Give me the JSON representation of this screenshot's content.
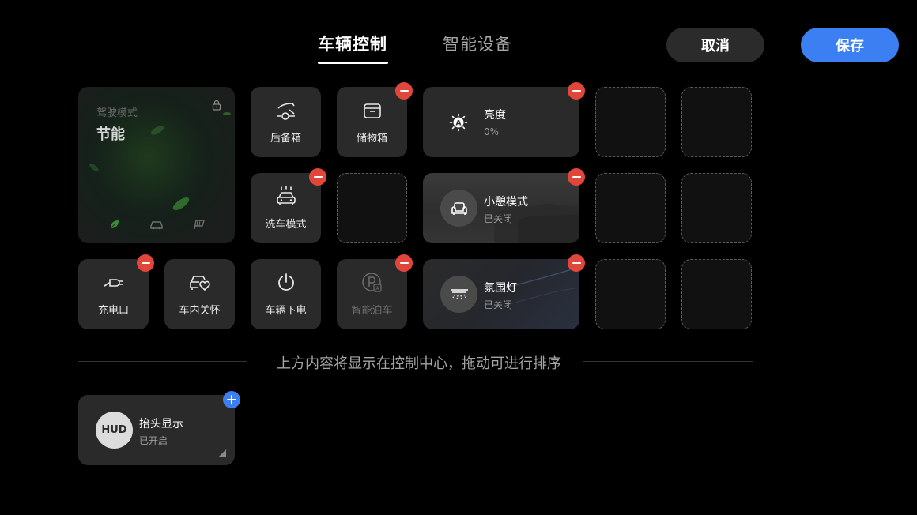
{
  "header": {
    "tabs": [
      {
        "label": "车辆控制",
        "active": true
      },
      {
        "label": "智能设备",
        "active": false
      }
    ],
    "cancel_label": "取消",
    "save_label": "保存"
  },
  "colors": {
    "accent": "#3b7ff2",
    "remove": "#e0473a",
    "tile_bg": "#2a2a2a",
    "background": "#000000"
  },
  "driving_mode": {
    "title": "驾驶模式",
    "mode": "节能",
    "icons": [
      "leaf-icon",
      "car-icon",
      "flag-icon"
    ]
  },
  "tiles": {
    "trunk": {
      "label": "后备箱",
      "icon": "trunk-icon"
    },
    "storage": {
      "label": "储物箱",
      "icon": "storage-box-icon"
    },
    "car_wash": {
      "label": "洗车模式",
      "icon": "car-wash-icon"
    },
    "charge_port": {
      "label": "充电口",
      "icon": "charging-plug-icon"
    },
    "cabin_care": {
      "label": "车内关怀",
      "icon": "car-heart-icon"
    },
    "power_off": {
      "label": "车辆下电",
      "icon": "power-icon"
    },
    "smart_parking": {
      "label": "智能泊车",
      "icon": "parking-icon"
    }
  },
  "wide_tiles": {
    "brightness": {
      "title": "亮度",
      "value": "0%",
      "icon": "auto-brightness-icon"
    },
    "rest_mode": {
      "title": "小憩模式",
      "status": "已关闭",
      "icon": "seat-icon"
    },
    "ambient_light": {
      "title": "氛围灯",
      "status": "已关闭",
      "icon": "ambient-light-icon"
    }
  },
  "hint": "上方内容将显示在控制中心，拖动可进行排序",
  "available": {
    "hud": {
      "title": "抬头显示",
      "status": "已开启",
      "icon_text": "HUD"
    }
  }
}
